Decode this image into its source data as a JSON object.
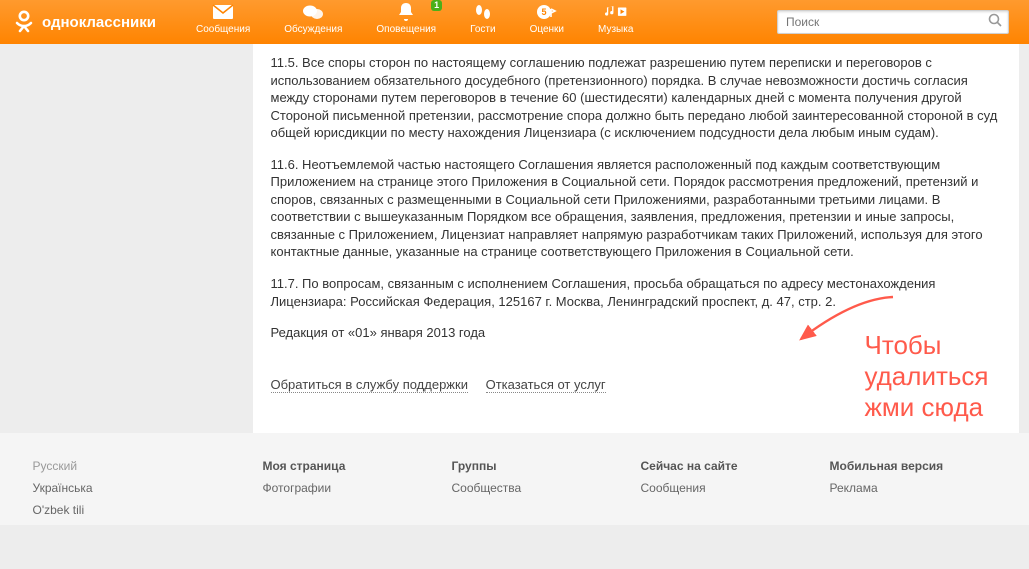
{
  "brand": {
    "name": "одноклассники"
  },
  "nav": {
    "messages": {
      "label": "Сообщения"
    },
    "discussions": {
      "label": "Обсуждения"
    },
    "notifications": {
      "label": "Оповещения",
      "badge": "1"
    },
    "guests": {
      "label": "Гости"
    },
    "marks": {
      "label": "Оценки"
    },
    "music": {
      "label": "Музыка"
    }
  },
  "search": {
    "placeholder": "Поиск"
  },
  "doc": {
    "p115": "11.5. Все споры сторон по настоящему соглашению подлежат разрешению путем переписки и переговоров с использованием обязательного досудебного (претензионного) порядка. В случае невозможности достичь согласия между сторонами путем переговоров в течение 60 (шестидесяти) календарных дней с момента получения другой Стороной письменной претензии, рассмотрение спора должно быть передано любой заинтересованной стороной в суд общей юрисдикции по месту нахождения Лицензиара (с исключением подсудности дела любым иным судам).",
    "p116": "11.6. Неотъемлемой частью настоящего Соглашения является расположенный под каждым соответствующим Приложением на странице этого Приложения в Социальной сети. Порядок рассмотрения предложений, претензий и споров, связанных с размещенными в Социальной сети Приложениями, разработанными третьими лицами. В соответствии с вышеуказанным Порядком все обращения, заявления, предложения, претензии и иные запросы, связанные с Приложением, Лицензиат направляет напрямую разработчикам таких Приложений, используя для этого контактные данные, указанные на странице соответствующего Приложения в Социальной сети.",
    "p117": "11.7. По вопросам, связанным с исполнением Соглашения, просьба обращаться по адресу местонахождения Лицензиара: Российская Федерация, 125167 г. Москва, Ленинградский проспект, д. 47, стр. 2.",
    "revision": "Редакция от «01» января 2013 года",
    "support_link": "Обратиться в службу поддержки",
    "decline_link": "Отказаться от услуг"
  },
  "annotation": {
    "line1": "Чтобы",
    "line2": "удалиться",
    "line3": "жми сюда"
  },
  "footer": {
    "langs": {
      "active": "Русский",
      "ua": "Українська",
      "uz": "O'zbek tili"
    },
    "col1": {
      "head": "Моя страница",
      "item1": "Фотографии",
      "item2": ""
    },
    "col2": {
      "head": "Группы",
      "item1": "Сообщества"
    },
    "col3": {
      "head": "Сейчас на сайте",
      "item1": "Сообщения"
    },
    "col4": {
      "head": "Мобильная версия",
      "item1": "Реклама",
      "item2": ""
    }
  }
}
